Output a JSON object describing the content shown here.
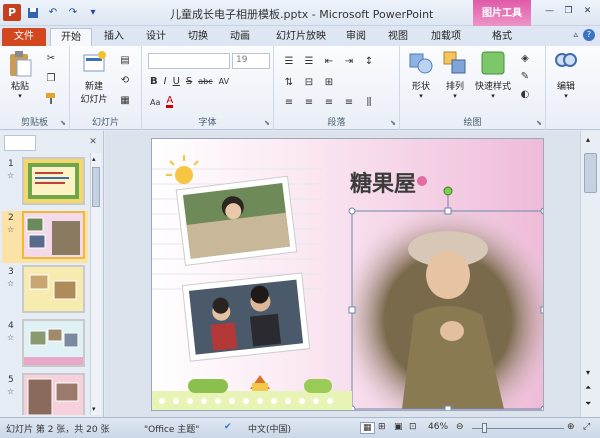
{
  "app": {
    "title": "儿童成长电子相册模板.pptx - Microsoft PowerPoint",
    "context_group": "图片工具"
  },
  "tabs": [
    "文件",
    "开始",
    "插入",
    "设计",
    "切换",
    "动画",
    "幻灯片放映",
    "审阅",
    "视图",
    "加载项",
    "格式"
  ],
  "ribbon": {
    "clipboard": {
      "paste": "粘贴",
      "label": "剪贴板"
    },
    "slides": {
      "new_slide": "新建",
      "new_slide2": "幻灯片",
      "label": "幻灯片"
    },
    "font": {
      "size": "19",
      "label": "字体",
      "buttons": [
        "B",
        "I",
        "U",
        "S",
        "abc",
        "AV",
        "Aa",
        "A"
      ]
    },
    "paragraph": {
      "label": "段落"
    },
    "drawing": {
      "shape": "形状",
      "arrange": "排列",
      "quick_styles": "快速样式",
      "label": "绘图"
    },
    "editing": {
      "label": "编辑"
    }
  },
  "panel": {
    "tab_slides": "",
    "tab_outline": ""
  },
  "thumbs": [
    {
      "num": "1"
    },
    {
      "num": "2"
    },
    {
      "num": "3"
    },
    {
      "num": "4"
    },
    {
      "num": "5"
    }
  ],
  "slide": {
    "title_art": "糖果屋"
  },
  "status": {
    "slide_info": "幻灯片 第 2 张，共 20 张",
    "theme": "\"Office 主题\"",
    "lang": "中文(中国)",
    "zoom": "46%"
  },
  "colors": {
    "file_tab": "#d3471f",
    "ctx_tab": "#e05aa8",
    "selection": "#f3b738"
  }
}
